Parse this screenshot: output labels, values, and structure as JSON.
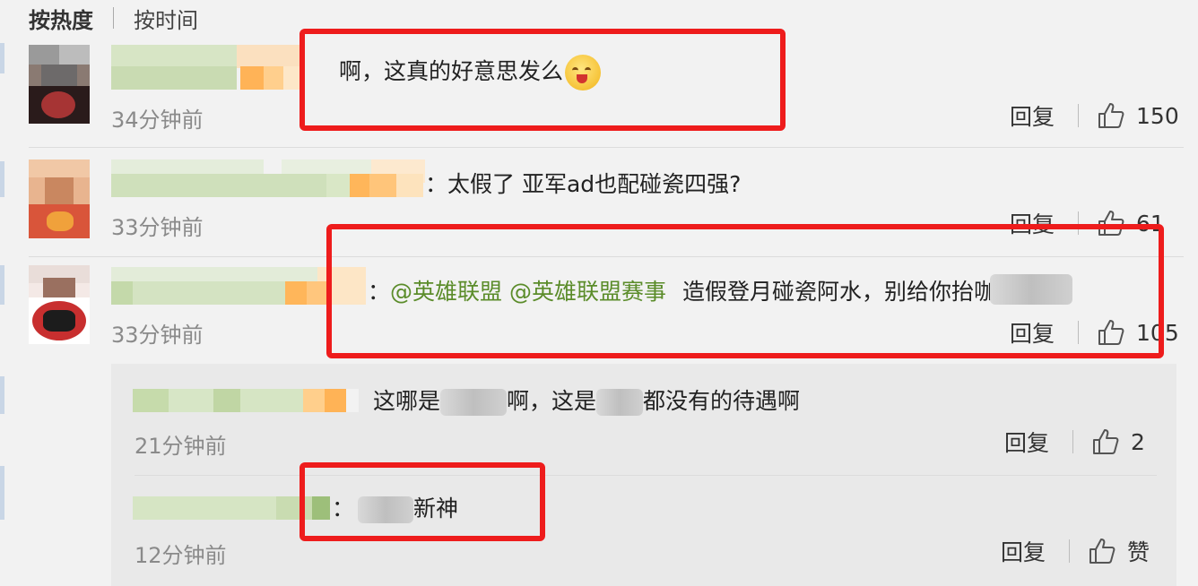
{
  "sort_tabs": {
    "hot": "按热度",
    "time": "按时间"
  },
  "comments": [
    {
      "text": "啊，这真的好意思发么",
      "time": "34分钟前",
      "reply_label": "回复",
      "likes": "150"
    },
    {
      "text": "：太假了 亚军ad也配碰瓷四强?",
      "time": "33分钟前",
      "reply_label": "回复",
      "likes": "61"
    },
    {
      "colon": "：",
      "mention1": "@英雄联盟",
      "mention2": "@英雄联盟赛事",
      "text_before": "造假登月碰瓷阿水，别给你",
      "text_after": "抬咖了",
      "time": "33分钟前",
      "reply_label": "回复",
      "likes": "105"
    }
  ],
  "replies": [
    {
      "part1": "这哪是",
      "part2": "啊，这是",
      "part3": "都没有的待遇啊",
      "time": "21分钟前",
      "reply_label": "回复",
      "likes": "2"
    },
    {
      "colon": "：",
      "text": "新神",
      "time": "12分钟前",
      "reply_label": "回复",
      "likes": "赞"
    }
  ],
  "icons": {
    "like": "thumbs-up-icon"
  },
  "colors": {
    "highlight": "#ee1c1c",
    "mention": "#5b8c2a",
    "timestamp": "#8a8a8a"
  }
}
